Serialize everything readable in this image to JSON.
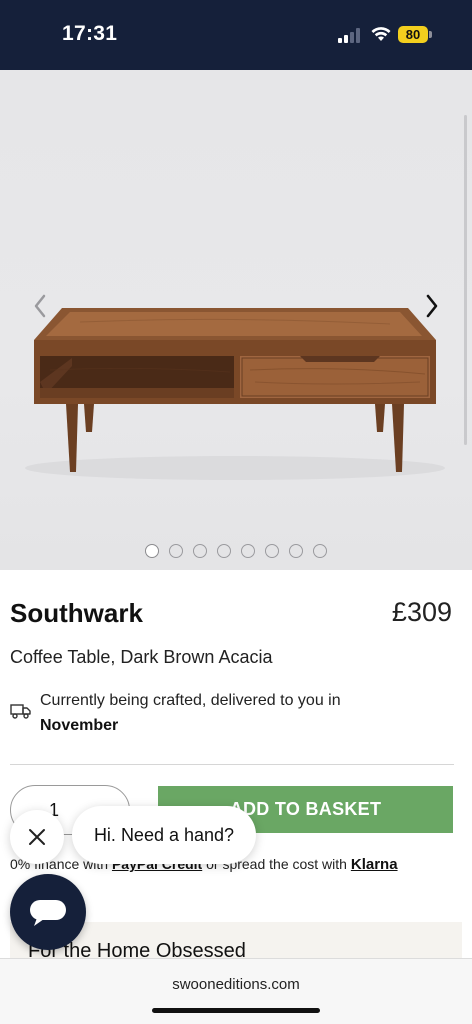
{
  "status": {
    "time": "17:31",
    "battery": "80"
  },
  "product": {
    "name": "Southwark",
    "price": "£309",
    "subtitle": "Coffee Table, Dark Brown Acacia",
    "delivery_text": "Currently being crafted, delivered to you in",
    "delivery_month": "November",
    "quantity": "1",
    "add_to_basket": "ADD TO BASKET"
  },
  "carousel": {
    "total": 8,
    "active": 1
  },
  "finance": {
    "prefix": "0% finance with",
    "paypal": "PayPal Credit",
    "middle": "or spread the cost with",
    "klarna": "Klarna"
  },
  "chat": {
    "prompt": "Hi. Need a hand?"
  },
  "promo": {
    "title": "For the Home Obsessed"
  },
  "browser": {
    "url": "swooneditions.com"
  },
  "colors": {
    "navy": "#15203a",
    "basket_green": "#6aa764",
    "battery_yellow": "#f3cf1e"
  },
  "icons": [
    "signal-icon",
    "wifi-icon",
    "battery-icon",
    "chevron-left-icon",
    "chevron-right-icon",
    "truck-icon",
    "close-icon",
    "chat-icon"
  ]
}
